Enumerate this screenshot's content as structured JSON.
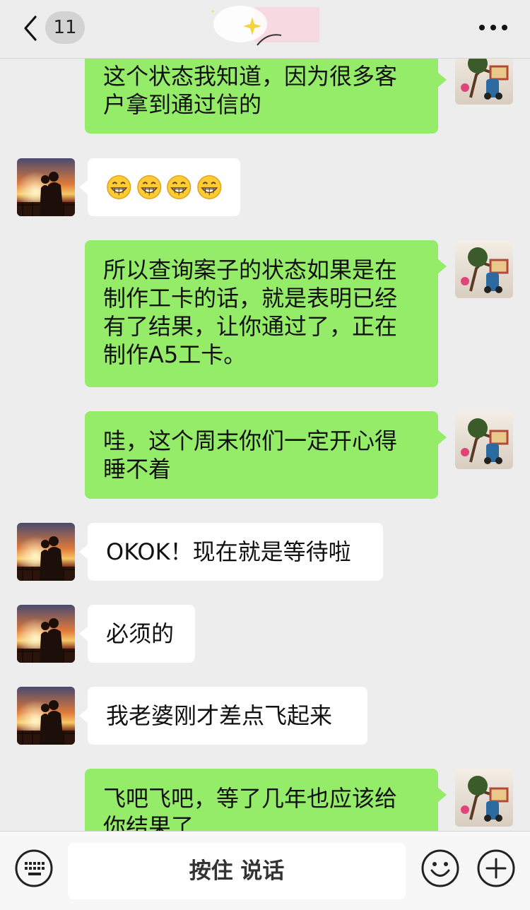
{
  "header": {
    "unread_count": "11",
    "back_icon": "chevron-left-icon",
    "more_icon": "more-dots-icon"
  },
  "messages": [
    {
      "side": "sent",
      "lines": [
        "这个状态我知道，因为很多客",
        "户拿到通过信的"
      ]
    },
    {
      "side": "recv",
      "emoji": [
        "😁",
        "😁",
        "😁",
        "😁"
      ]
    },
    {
      "side": "sent",
      "lines": [
        "所以查询案子的状态如果是在",
        "制作工卡的话，就是表明已经",
        "有了结果，让你通过了，正在",
        "制作A5工卡。"
      ]
    },
    {
      "side": "sent",
      "lines": [
        "哇，这个周末你们一定开心得",
        "睡不着"
      ]
    },
    {
      "side": "recv",
      "lines": [
        "OKOK！现在就是等待啦"
      ]
    },
    {
      "side": "recv",
      "lines": [
        "必须的"
      ]
    },
    {
      "side": "recv",
      "lines": [
        "我老婆刚才差点飞起来"
      ]
    },
    {
      "side": "sent",
      "lines": [
        "飞吧飞吧，等了几年也应该给",
        "你结果了"
      ]
    }
  ],
  "input_bar": {
    "hold_to_talk_label": "按住 说话",
    "keyboard_icon": "keyboard-icon",
    "emoji_icon": "emoji-icon",
    "plus_icon": "plus-circle-icon"
  },
  "colors": {
    "sent_bubble": "#95ec69",
    "recv_bubble": "#ffffff",
    "background": "#ededed"
  }
}
